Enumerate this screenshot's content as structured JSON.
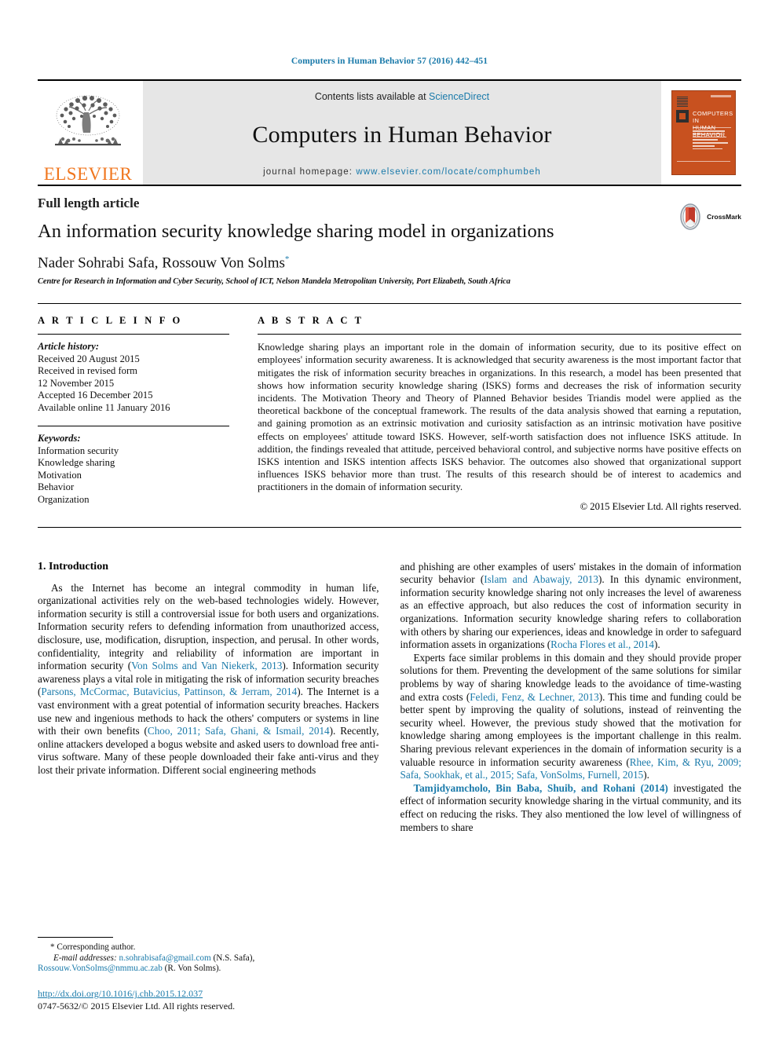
{
  "running_head": "Computers in Human Behavior 57 (2016) 442–451",
  "masthead": {
    "publisher_logo_text": "ELSEVIER",
    "contents_prefix": "Contents lists available at ",
    "contents_link": "ScienceDirect",
    "journal_title": "Computers in Human Behavior",
    "homepage_prefix": "journal homepage: ",
    "homepage_url": "www.elsevier.com/locate/comphumbeh",
    "cover_title_line1": "COMPUTERS IN",
    "cover_title_line2": "HUMAN BEHAVIOR",
    "accent_color": "#1a7aaa",
    "cover_color": "#c8511f",
    "elsevier_orange": "#f0761e"
  },
  "article": {
    "type": "Full length article",
    "title": "An information security knowledge sharing model in organizations",
    "authors": "Nader Sohrabi Safa, Rossouw Von Solms",
    "author_marker": "*",
    "affiliation": "Centre for Research in Information and Cyber Security, School of ICT, Nelson Mandela Metropolitan University, Port Elizabeth, South Africa",
    "crossmark_label": "CrossMark"
  },
  "article_info": {
    "heading": "A R T I C L E   I N F O",
    "history_label": "Article history:",
    "history": [
      "Received 20 August 2015",
      "Received in revised form",
      "12 November 2015",
      "Accepted 16 December 2015",
      "Available online 11 January 2016"
    ],
    "keywords_label": "Keywords:",
    "keywords": [
      "Information security",
      "Knowledge sharing",
      "Motivation",
      "Behavior",
      "Organization"
    ]
  },
  "abstract": {
    "heading": "A B S T R A C T",
    "text": "Knowledge sharing plays an important role in the domain of information security, due to its positive effect on employees' information security awareness. It is acknowledged that security awareness is the most important factor that mitigates the risk of information security breaches in organizations. In this research, a model has been presented that shows how information security knowledge sharing (ISKS) forms and decreases the risk of information security incidents. The Motivation Theory and Theory of Planned Behavior besides Triandis model were applied as the theoretical backbone of the conceptual framework. The results of the data analysis showed that earning a reputation, and gaining promotion as an extrinsic motivation and curiosity satisfaction as an intrinsic motivation have positive effects on employees' attitude toward ISKS. However, self-worth satisfaction does not influence ISKS attitude. In addition, the findings revealed that attitude, perceived behavioral control, and subjective norms have positive effects on ISKS intention and ISKS intention affects ISKS behavior. The outcomes also showed that organizational support influences ISKS behavior more than trust. The results of this research should be of interest to academics and practitioners in the domain of information security.",
    "copyright": "© 2015 Elsevier Ltd. All rights reserved."
  },
  "body": {
    "section_heading": "1. Introduction",
    "left_paragraphs": [
      {
        "segments": [
          {
            "t": "As the Internet has become an integral commodity in human life, organizational activities rely on the web-based technologies widely. However, information security is still a controversial issue for both users and organizations. Information security refers to defending information from unauthorized access, disclosure, use, modification, disruption, inspection, and perusal. In other words, confidentiality, integrity and reliability of information are important in information security (",
            "k": "text"
          },
          {
            "t": "Von Solms and Van Niekerk, 2013",
            "k": "cite"
          },
          {
            "t": "). Information security awareness plays a vital role in mitigating the risk of information security breaches (",
            "k": "text"
          },
          {
            "t": "Parsons, McCormac, Butavicius, Pattinson, & Jerram, 2014",
            "k": "cite"
          },
          {
            "t": "). The Internet is a vast environment with a great potential of information security breaches. Hackers use new and ingenious methods to hack the others' computers or systems in line with their own benefits (",
            "k": "text"
          },
          {
            "t": "Choo, 2011; Safa, Ghani, & Ismail, 2014",
            "k": "cite"
          },
          {
            "t": "). Recently, online attackers developed a bogus website and asked users to download free anti-virus software. Many of these people downloaded their fake anti-virus and they lost their private information. Different social engineering methods",
            "k": "text"
          }
        ]
      }
    ],
    "right_paragraphs": [
      {
        "segments": [
          {
            "t": "and phishing are other examples of users' mistakes in the domain of information security behavior (",
            "k": "text"
          },
          {
            "t": "Islam and Abawajy, 2013",
            "k": "cite"
          },
          {
            "t": "). In this dynamic environment, information security knowledge sharing not only increases the level of awareness as an effective approach, but also reduces the cost of information security in organizations. Information security knowledge sharing refers to collaboration with others by sharing our experiences, ideas and knowledge in order to safeguard information assets in organizations (",
            "k": "text"
          },
          {
            "t": "Rocha Flores et al., 2014",
            "k": "cite"
          },
          {
            "t": ").",
            "k": "text"
          }
        ],
        "no_indent": true
      },
      {
        "segments": [
          {
            "t": "Experts face similar problems in this domain and they should provide proper solutions for them. Preventing the development of the same solutions for similar problems by way of sharing knowledge leads to the avoidance of time-wasting and extra costs (",
            "k": "text"
          },
          {
            "t": "Feledi, Fenz, & Lechner, 2013",
            "k": "cite"
          },
          {
            "t": "). This time and funding could be better spent by improving the quality of solutions, instead of reinventing the security wheel. However, the previous study showed that the motivation for knowledge sharing among employees is the important challenge in this realm. Sharing previous relevant experiences in the domain of information security is a valuable resource in information security awareness (",
            "k": "text"
          },
          {
            "t": "Rhee, Kim, & Ryu, 2009; Safa, Sookhak, et al., 2015; Safa, VonSolms, Furnell, 2015",
            "k": "cite"
          },
          {
            "t": ").",
            "k": "text"
          }
        ]
      },
      {
        "segments": [
          {
            "t": "Tamjidyamcholo, Bin Baba, Shuib, and Rohani (2014)",
            "k": "cite-lead"
          },
          {
            "t": " investigated the effect of information security knowledge sharing in the virtual community, and its effect on reducing the risks. They also mentioned the low level of willingness of members to share",
            "k": "text"
          }
        ]
      }
    ]
  },
  "footnote": {
    "corresponding_marker": "*",
    "corresponding_text": " Corresponding author.",
    "email_label": "E-mail addresses:",
    "email1": "n.sohrabisafa@gmail.com",
    "email1_owner": " (N.S. Safa), ",
    "email2": "Rossouw.VonSolms@nmmu.ac.zab",
    "email2_owner": " (R. Von Solms).",
    "doi": "http://dx.doi.org/10.1016/j.chb.2015.12.037",
    "issn": "0747-5632/© 2015 Elsevier Ltd. All rights reserved."
  }
}
